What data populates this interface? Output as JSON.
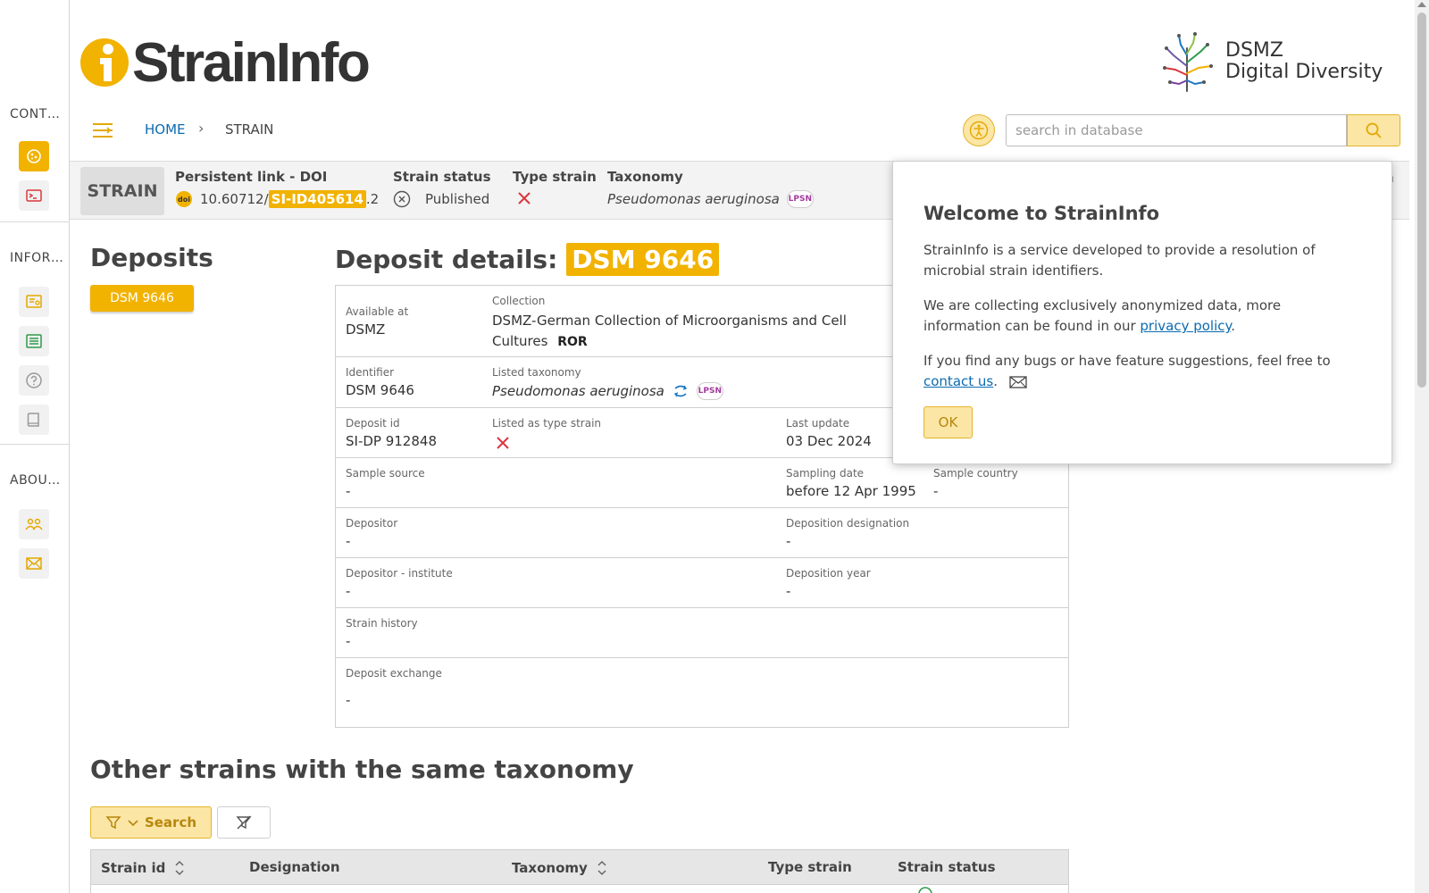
{
  "sidebar": {
    "sections": [
      {
        "label": "CONT…"
      },
      {
        "label": "INFOR…"
      },
      {
        "label": "ABOU…"
      }
    ],
    "buttons": [
      {
        "icon": "strain-icon",
        "active": true
      },
      {
        "icon": "terminal-icon"
      },
      {
        "icon": "news-icon"
      },
      {
        "icon": "list-icon"
      },
      {
        "icon": "help-icon"
      },
      {
        "icon": "book-icon"
      },
      {
        "icon": "team-icon"
      },
      {
        "icon": "mail-icon"
      }
    ]
  },
  "header": {
    "logo_text": "StrainInfo",
    "partner_line1": "DSMZ",
    "partner_line2": "Digital Diversity"
  },
  "nav": {
    "breadcrumb_home": "HOME",
    "breadcrumb_separator": "›",
    "breadcrumb_current": "STRAIN",
    "search_placeholder": "search in database"
  },
  "strain_bar": {
    "tag": "STRAIN",
    "doi_heading": "Persistent link - DOI",
    "doi_prefix": "10.60712/",
    "doi_highlight": "SI-ID405614",
    "doi_suffix": ".2",
    "status_heading": "Strain status",
    "status_value": "Published",
    "type_heading": "Type strain",
    "taxonomy_heading": "Taxonomy",
    "taxonomy_value": "Pseudomonas aeruginosa",
    "lpsn_badge": "LPSN",
    "hidden_heading": "n"
  },
  "deposits": {
    "heading": "Deposits",
    "chip": "DSM 9646"
  },
  "details": {
    "heading": "Deposit details:",
    "heading_id": "DSM 9646",
    "available_label": "Available at",
    "available_value": "DSMZ",
    "collection_label": "Collection",
    "collection_value": "DSMZ-German Collection of Microorganisms and Cell Cultures",
    "ror_badge": "ROR",
    "identifier_label": "Identifier",
    "identifier_value": "DSM 9646",
    "listed_tax_label": "Listed taxonomy",
    "listed_tax_value": "Pseudomonas aeruginosa",
    "lpsn_badge": "LPSN",
    "deposit_id_label": "Deposit id",
    "deposit_id_value": "SI-DP 912848",
    "listed_type_label": "Listed as type strain",
    "last_update_label": "Last update",
    "last_update_value": "03 Dec 2024",
    "sample_source_label": "Sample source",
    "sample_source_value": "-",
    "sampling_date_label": "Sampling date",
    "sampling_date_value": "before 12 Apr 1995",
    "sample_country_label": "Sample country",
    "sample_country_value": "-",
    "depositor_label": "Depositor",
    "depositor_value": "-",
    "deposition_designation_label": "Deposition designation",
    "deposition_designation_value": "-",
    "depositor_institute_label": "Depositor - institute",
    "depositor_institute_value": "-",
    "deposition_year_label": "Deposition year",
    "deposition_year_value": "-",
    "strain_history_label": "Strain history",
    "strain_history_value": "-",
    "deposit_exchange_label": "Deposit exchange",
    "deposit_exchange_value": "-"
  },
  "other_strains": {
    "heading": "Other strains with the same taxonomy",
    "filter_button": "Search",
    "columns": [
      "Strain id",
      "Designation",
      "Taxonomy",
      "Type strain",
      "Strain status"
    ]
  },
  "popup": {
    "title": "Welcome to StrainInfo",
    "p1": "StrainInfo is a service developed to provide a resolution of microbial strain identifiers.",
    "p2_before": "We are collecting exclusively anonymized data, more information can be found in our ",
    "p2_link": "privacy policy",
    "p2_after": ".",
    "p3_before": "If you find any bugs or have feature suggestions, feel free to ",
    "p3_link": "contact us",
    "p3_after": ".",
    "ok": "OK"
  },
  "colors": {
    "accent": "#f2b200",
    "accent_light": "#fbe6a6",
    "link": "#0c6bb0",
    "error_red": "#d9363e"
  }
}
